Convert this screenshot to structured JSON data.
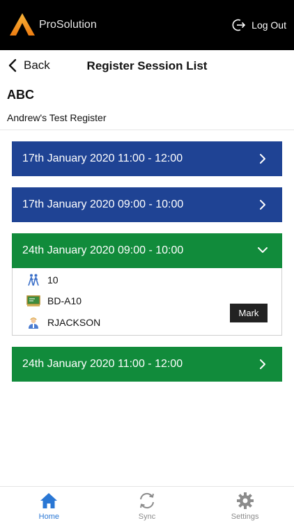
{
  "app": {
    "brand": "ProSolution",
    "logout_label": "Log Out"
  },
  "nav": {
    "back_label": "Back",
    "title": "Register Session List"
  },
  "register": {
    "code": "ABC",
    "name": "Andrew's Test Register"
  },
  "sessions": [
    {
      "label": "17th January 2020 11:00 - 12:00",
      "color": "#1f4394",
      "expanded": false
    },
    {
      "label": "17th January 2020 09:00 - 10:00",
      "color": "#1f4394",
      "expanded": false
    },
    {
      "label": "24th January 2020 09:00 - 10:00",
      "color": "#118b3b",
      "expanded": true
    },
    {
      "label": "24th January 2020 11:00 - 12:00",
      "color": "#118b3b",
      "expanded": false
    }
  ],
  "expanded_session": {
    "students_count": "10",
    "room": "BD-A10",
    "lecturer": "RJACKSON",
    "mark_label": "Mark",
    "icons": [
      "students-icon",
      "room-icon",
      "lecturer-icon"
    ]
  },
  "tabs": [
    {
      "label": "Home",
      "icon": "home-icon",
      "active": true
    },
    {
      "label": "Sync",
      "icon": "sync-icon",
      "active": false
    },
    {
      "label": "Settings",
      "icon": "gear-icon",
      "active": false
    }
  ],
  "colors": {
    "accent": "#2a77d4",
    "blue": "#1f4394",
    "green": "#118b3b",
    "logo_orange": "#f39a1f"
  }
}
